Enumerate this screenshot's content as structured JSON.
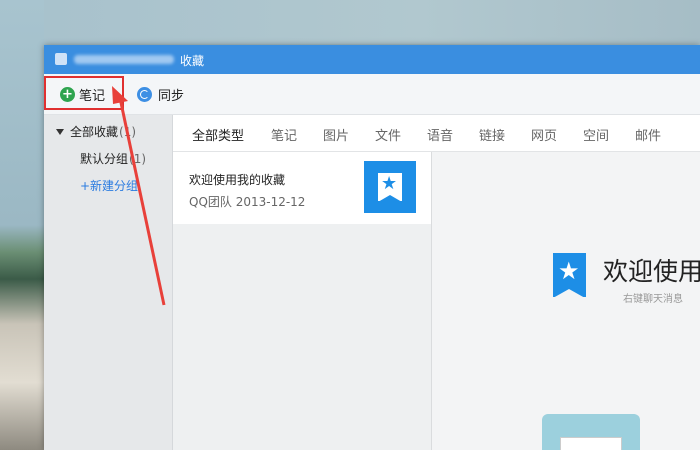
{
  "window": {
    "title": "收藏"
  },
  "toolbar": {
    "note_label": "笔记",
    "sync_label": "同步"
  },
  "sidebar": {
    "all_label": "全部收藏",
    "all_count": "(1)",
    "default_group": "默认分组",
    "default_count": "(1)",
    "new_group": "+新建分组"
  },
  "tabs": [
    "全部类型",
    "笔记",
    "图片",
    "文件",
    "语音",
    "链接",
    "网页",
    "空间",
    "邮件"
  ],
  "list": {
    "items": [
      {
        "title": "欢迎使用我的收藏",
        "meta": "QQ团队 2013-12-12"
      }
    ]
  },
  "detail": {
    "welcome": "欢迎使用",
    "subtitle": "右键聊天消息"
  },
  "colors": {
    "titlebar": "#3a8ee0",
    "accent": "#1d8ee6",
    "highlight": "#e03030",
    "add": "#2ea44f"
  },
  "icons": {
    "add": "plus-circle-icon",
    "sync": "sync-icon",
    "favorite": "star-bookmark-icon"
  }
}
